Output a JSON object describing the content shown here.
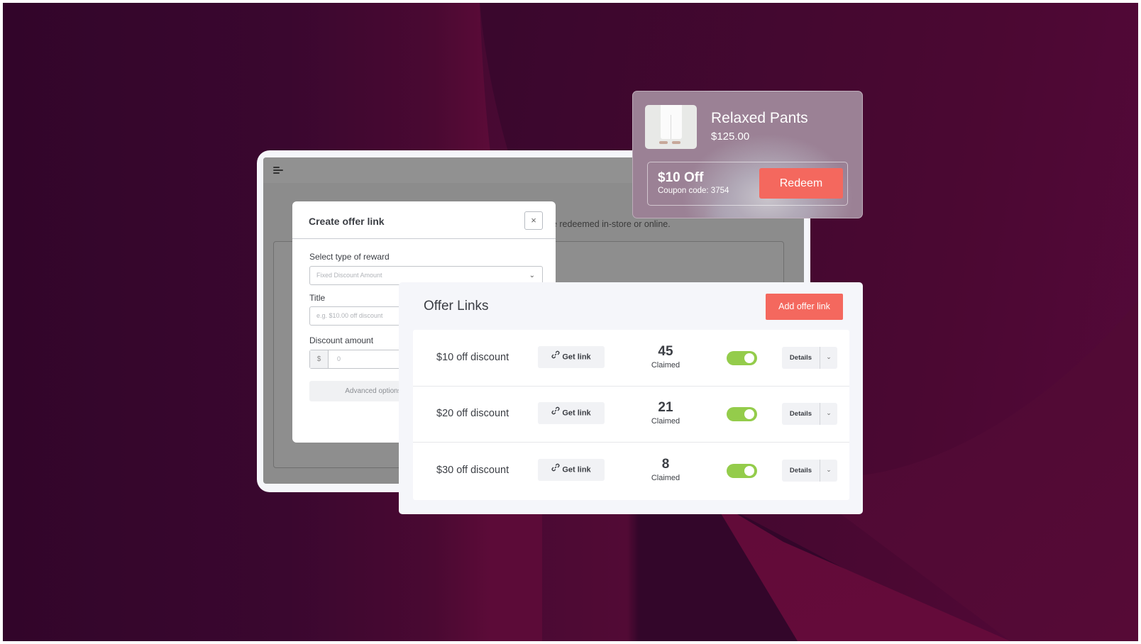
{
  "colors": {
    "accent": "#f4685e",
    "toggle_on": "#94cc4b",
    "background_dark": "#33062a",
    "background_wine": "#5c0b38"
  },
  "background_app": {
    "menu_icon": "hamburger-menu-icon",
    "description_fragment": "be redeemed in-store or online."
  },
  "create_modal": {
    "title": "Create offer link",
    "close_icon": "close-icon",
    "close_glyph": "×",
    "reward_type_label": "Select type of reward",
    "reward_type_value": "Fixed Discount Amount",
    "chevron_glyph": "⌄",
    "title_label": "Title",
    "title_placeholder": "e.g. $10.00 off discount",
    "discount_label": "Discount amount",
    "discount_prefix": "$",
    "discount_placeholder": "0",
    "advanced_label": "Advanced options"
  },
  "product_card": {
    "name": "Relaxed Pants",
    "price": "$125.00",
    "coupon_amount": "$10 Off",
    "coupon_code": "Coupon code: 3754",
    "redeem_label": "Redeem"
  },
  "offers": {
    "title": "Offer Links",
    "add_label": "Add offer link",
    "get_link_label": "Get link",
    "claimed_label": "Claimed",
    "details_label": "Details",
    "chevron_glyph": "⌄",
    "rows": [
      {
        "name": "$10 off discount",
        "claimed": "45",
        "enabled": true
      },
      {
        "name": "$20 off discount",
        "claimed": "21",
        "enabled": true
      },
      {
        "name": "$30 off discount",
        "claimed": "8",
        "enabled": true
      }
    ]
  }
}
